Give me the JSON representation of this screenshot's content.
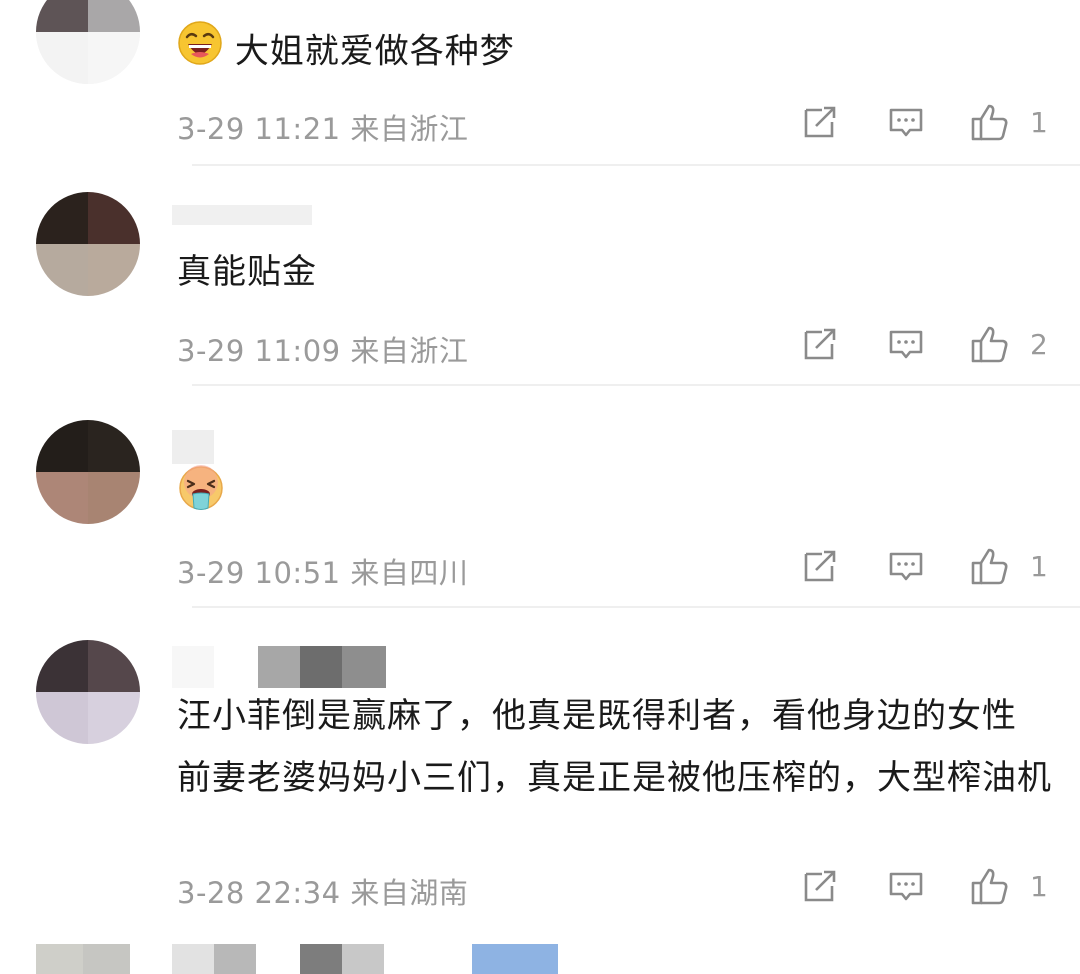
{
  "comments": [
    {
      "text": "大姐就爱做各种梦",
      "emoji": "laughing-emoji",
      "time": "3-29 11:21",
      "location": "来自浙江",
      "likes": "1"
    },
    {
      "text": "真能贴金",
      "time": "3-29 11:09",
      "location": "来自浙江",
      "likes": "2"
    },
    {
      "text": "",
      "emoji": "vomiting-emoji",
      "time": "3-29 10:51",
      "location": "来自四川",
      "likes": "1"
    },
    {
      "text": "汪小菲倒是赢麻了，他真是既得利者，看他身边的女性 前妻老婆妈妈小三们，真是正是被他压榨的，大型榨油机",
      "time": "3-28 22:34",
      "location": "来自湖南",
      "likes": "1"
    }
  ],
  "icons": {
    "repost": "repost-icon",
    "comment": "comment-icon",
    "like": "thumbs-up-icon"
  },
  "colors": {
    "text": "#1a1a1a",
    "meta": "#9a9a9a",
    "divider": "#efefef"
  }
}
